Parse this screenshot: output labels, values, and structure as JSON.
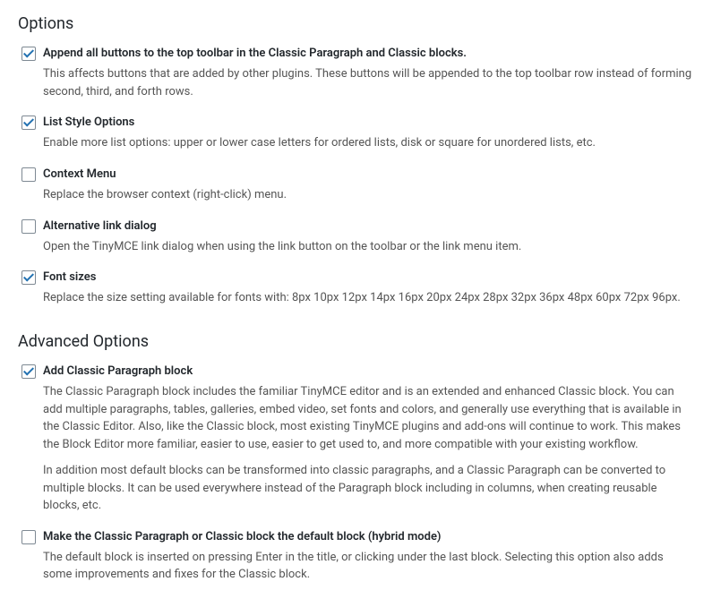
{
  "sections": {
    "options": {
      "heading": "Options",
      "items": [
        {
          "checked": true,
          "label": "Append all buttons to the top toolbar in the Classic Paragraph and Classic blocks.",
          "desc": "This affects buttons that are added by other plugins. These buttons will be appended to the top toolbar row instead of forming second, third, and forth rows."
        },
        {
          "checked": true,
          "label": "List Style Options",
          "desc": "Enable more list options: upper or lower case letters for ordered lists, disk or square for unordered lists, etc."
        },
        {
          "checked": false,
          "label": "Context Menu",
          "desc": "Replace the browser context (right-click) menu."
        },
        {
          "checked": false,
          "label": "Alternative link dialog",
          "desc": "Open the TinyMCE link dialog when using the link button on the toolbar or the link menu item."
        },
        {
          "checked": true,
          "label": "Font sizes",
          "desc": "Replace the size setting available for fonts with: 8px 10px 12px 14px 16px 20px 24px 28px 32px 36px 48px 60px 72px 96px."
        }
      ]
    },
    "advanced": {
      "heading": "Advanced Options",
      "items": [
        {
          "checked": true,
          "label": "Add Classic Paragraph block",
          "desc": "The Classic Paragraph block includes the familiar TinyMCE editor and is an extended and enhanced Classic block. You can add multiple paragraphs, tables, galleries, embed video, set fonts and colors, and generally use everything that is available in the Classic Editor. Also, like the Classic block, most existing TinyMCE plugins and add-ons will continue to work. This makes the Block Editor more familiar, easier to use, easier to get used to, and more compatible with your existing workflow.",
          "desc2": "In addition most default blocks can be transformed into classic paragraphs, and a Classic Paragraph can be converted to multiple blocks. It can be used everywhere instead of the Paragraph block including in columns, when creating reusable blocks, etc."
        },
        {
          "checked": false,
          "label": "Make the Classic Paragraph or Classic block the default block (hybrid mode)",
          "desc": "The default block is inserted on pressing Enter in the title, or clicking under the last block. Selecting this option also adds some improvements and fixes for the Classic block."
        }
      ]
    }
  }
}
